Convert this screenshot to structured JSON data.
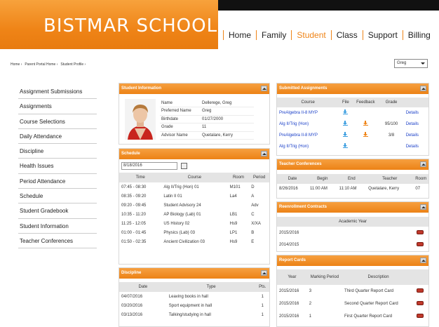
{
  "school_name": "BISTMAR SCHOOL",
  "nav": [
    "Home",
    "Family",
    "Student",
    "Class",
    "Support",
    "Billing"
  ],
  "nav_active": "Student",
  "breadcrumb": [
    "Home",
    "Parent Portal Home",
    "Student Profile"
  ],
  "student_select": "Greg",
  "sidebar": [
    "Assignment Submissions",
    "Assignments",
    "Course Selections",
    "Daily Attendance",
    "Discipline",
    "Health Issues",
    "Period Attendance",
    "Schedule",
    "Student Gradebook",
    "Student Information",
    "Teacher Conferences"
  ],
  "student_info": {
    "title": "Student Information",
    "rows": [
      [
        "Name",
        "Dellerege, Greg"
      ],
      [
        "Preferred Name",
        "Greg"
      ],
      [
        "Birthdate",
        "01/27/2000"
      ],
      [
        "Grade",
        "11"
      ],
      [
        "Advisor Name",
        "Quetalare, Kerry"
      ]
    ]
  },
  "schedule": {
    "title": "Schedule",
    "date": "8/18/2016",
    "headers": [
      "Time",
      "Course",
      "Room",
      "Period"
    ],
    "rows": [
      [
        "07:45 - 08:30",
        "Alg II/Trig (Hon) 01",
        "M101",
        "D"
      ],
      [
        "08:35 - 09:20",
        "Latin II 01",
        "La4",
        "A"
      ],
      [
        "09:20 - 09:45",
        "Student Advisory 24",
        "",
        "Adv"
      ],
      [
        "10:35 - 11:20",
        "AP Biology (Lab) 01",
        "LB1",
        "C"
      ],
      [
        "11:25 - 12:05",
        "US History 02",
        "Hs9",
        "X/XA"
      ],
      [
        "01:00 - 01:45",
        "Physics (Lab) 03",
        "LP1",
        "B"
      ],
      [
        "01:50 - 02:35",
        "Ancient Civilization 03",
        "Hs9",
        "E"
      ]
    ]
  },
  "discipline": {
    "title": "Discipline",
    "headers": [
      "Date",
      "Type",
      "Pts."
    ],
    "rows": [
      [
        "04/07/2016",
        "Leaving books in hall",
        "1"
      ],
      [
        "03/20/2016",
        "Sport equipment in hall",
        "1"
      ],
      [
        "03/13/2016",
        "Talking/studying in hall",
        "1"
      ]
    ]
  },
  "submitted": {
    "title": "Submitted Assignments",
    "headers": [
      "Course",
      "File",
      "Feedback",
      "Grade",
      ""
    ],
    "rows": [
      {
        "course": "PreAlgebra II-8 MYP",
        "feedback": false,
        "grade": "",
        "link": "Details"
      },
      {
        "course": "Alg II/Trig (Hon)",
        "feedback": true,
        "grade": "95/100",
        "link": "Details"
      },
      {
        "course": "PreAlgebra II-8 MYP",
        "feedback": true,
        "grade": "3/8",
        "link": "Details"
      },
      {
        "course": "Alg II/Trig (Hon)",
        "feedback": false,
        "grade": "",
        "link": "Details"
      }
    ]
  },
  "conferences": {
    "title": "Teacher Conferences",
    "headers": [
      "Date",
      "Begin",
      "End",
      "Teacher",
      "Room"
    ],
    "rows": [
      [
        "8/26/2016",
        "11:00 AM",
        "11:10 AM",
        "Quetalare, Kerry",
        "07"
      ]
    ]
  },
  "reenrollment": {
    "title": "Reenrollment Contracts",
    "headers": [
      "Academic Year"
    ],
    "rows": [
      "2015/2016",
      "2014/2015"
    ]
  },
  "report_cards": {
    "title": "Report Cards",
    "headers": [
      "Year",
      "Marking Period",
      "Description"
    ],
    "rows": [
      [
        "2015/2016",
        "3",
        "Third Quarter Report Card"
      ],
      [
        "2015/2016",
        "2",
        "Second Quarter Report Card"
      ],
      [
        "2015/2016",
        "1",
        "First Quarter Report Card"
      ]
    ]
  }
}
